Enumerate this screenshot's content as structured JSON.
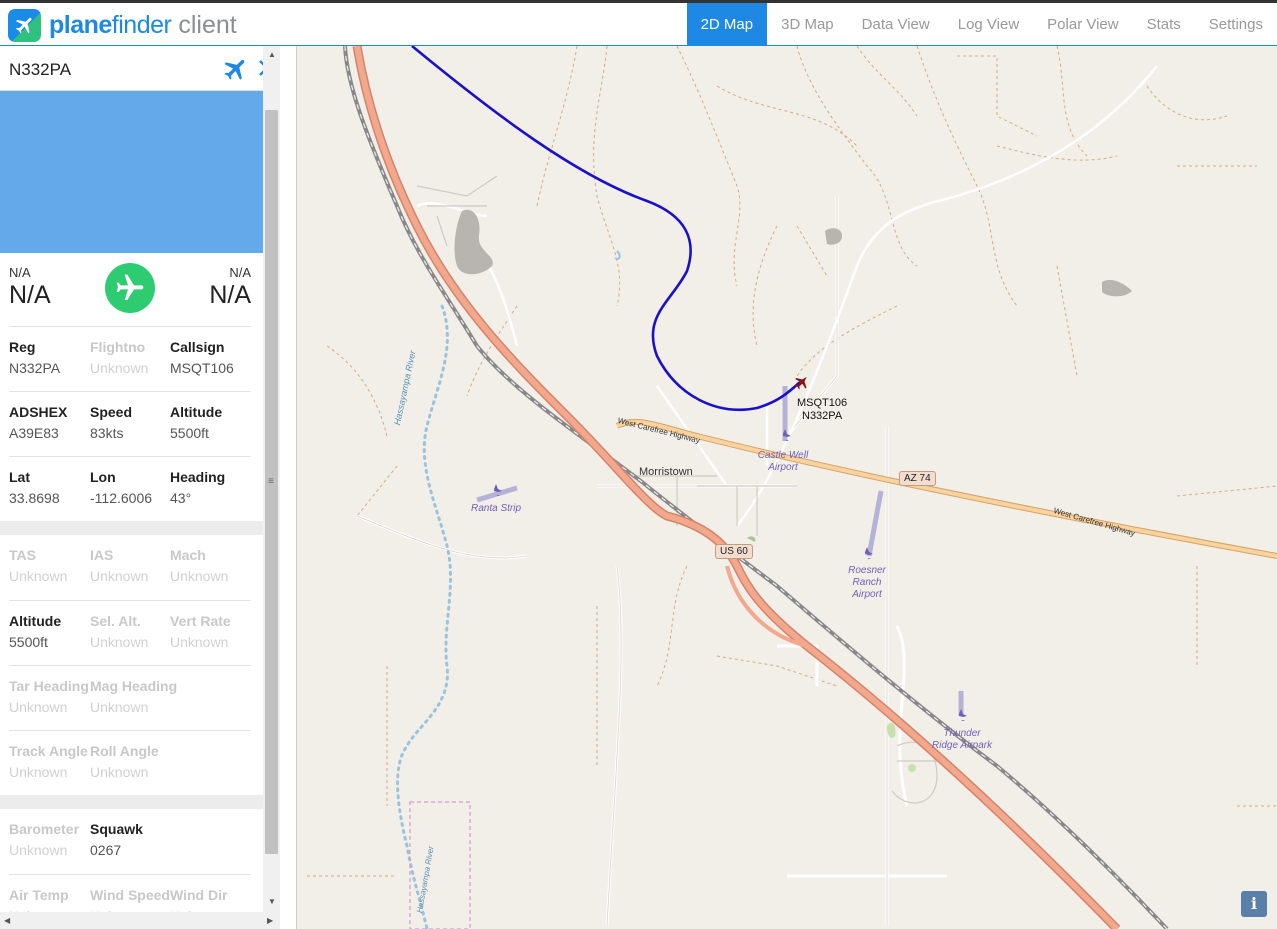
{
  "app": {
    "brand_bold": "plane",
    "brand_regular": "finder",
    "brand_suffix": "client",
    "accent": "#1e88e5"
  },
  "nav": {
    "tabs": [
      {
        "label": "2D Map",
        "active": true
      },
      {
        "label": "3D Map",
        "active": false
      },
      {
        "label": "Data View",
        "active": false
      },
      {
        "label": "Log View",
        "active": false
      },
      {
        "label": "Polar View",
        "active": false
      },
      {
        "label": "Stats",
        "active": false
      },
      {
        "label": "Settings",
        "active": false
      }
    ]
  },
  "sidebar": {
    "registration": "N332PA",
    "origin": {
      "code": "N/A",
      "name": "N/A"
    },
    "destination": {
      "code": "N/A",
      "name": "N/A"
    },
    "fields": {
      "reg": {
        "label": "Reg",
        "value": "N332PA"
      },
      "flightno": {
        "label": "Flightno",
        "value": "Unknown"
      },
      "callsign": {
        "label": "Callsign",
        "value": "MSQT106"
      },
      "adshex": {
        "label": "ADSHEX",
        "value": "A39E83"
      },
      "speed": {
        "label": "Speed",
        "value": "83kts"
      },
      "altitude": {
        "label": "Altitude",
        "value": "5500ft"
      },
      "lat": {
        "label": "Lat",
        "value": "33.8698"
      },
      "lon": {
        "label": "Lon",
        "value": "-112.6006"
      },
      "heading": {
        "label": "Heading",
        "value": "43°"
      },
      "tas": {
        "label": "TAS",
        "value": "Unknown"
      },
      "ias": {
        "label": "IAS",
        "value": "Unknown"
      },
      "mach": {
        "label": "Mach",
        "value": "Unknown"
      },
      "altitude2": {
        "label": "Altitude",
        "value": "5500ft"
      },
      "sel_alt": {
        "label": "Sel. Alt.",
        "value": "Unknown"
      },
      "vert_rate": {
        "label": "Vert Rate",
        "value": "Unknown"
      },
      "tar_heading": {
        "label": "Tar Heading",
        "value": "Unknown"
      },
      "mag_heading": {
        "label": "Mag Heading",
        "value": "Unknown"
      },
      "track_angle": {
        "label": "Track Angle",
        "value": "Unknown"
      },
      "roll_angle": {
        "label": "Roll Angle",
        "value": "Unknown"
      },
      "barometer": {
        "label": "Barometer",
        "value": "Unknown"
      },
      "squawk": {
        "label": "Squawk",
        "value": "0267"
      },
      "air_temp": {
        "label": "Air Temp",
        "value": "Unknown"
      },
      "wind_speed": {
        "label": "Wind Speed",
        "value": "Unknown"
      },
      "wind_dir": {
        "label": "Wind Dir",
        "value": "Unknown"
      }
    }
  },
  "map": {
    "aircraft_label_1": "MSQT106",
    "aircraft_label_2": "N332PA",
    "places": {
      "morristown": "Morristown",
      "castle_well_1": "Castle Well",
      "castle_well_2": "Airport",
      "ranta": "Ranta Strip",
      "roesner_1": "Roesner",
      "roesner_2": "Ranch",
      "roesner_3": "Airport",
      "thunder_1": "Thunder",
      "thunder_2": "Ridge Airpark",
      "river_1": "Hassayampa River",
      "river_2": "Hassayampa River",
      "hwy_1": "West Carefree Highway",
      "hwy_2": "West Carefree Highway",
      "az74": "AZ 74",
      "us60": "US 60"
    },
    "info_label": "i",
    "track_color": "#1a10c8"
  }
}
